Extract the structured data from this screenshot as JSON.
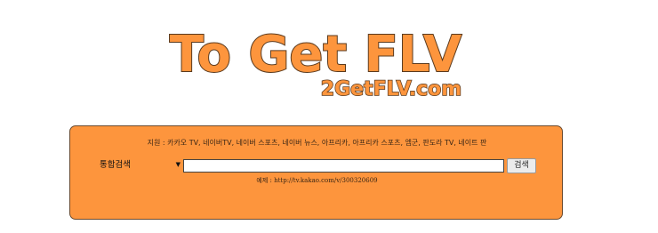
{
  "logo": {
    "title": "To Get FLV",
    "subtitle": "2GetFLV.com",
    "fill_color": "#fd953d",
    "outline_color": "#5a3a1e"
  },
  "panel": {
    "background": "#fd953d",
    "supported_text": "지원 : 카카오 TV, 네이버TV, 네이버 스포츠, 네이버 뉴스, 아프리카, 아프리카 스포츠, 엠군, 판도라 TV, 네이트 판",
    "select": {
      "selected": "통합검색",
      "arrow_icon": "chevron-down-icon"
    },
    "input": {
      "value": "",
      "placeholder": ""
    },
    "search_button_label": "검색",
    "example_text": "예제 : http://tv.kakao.com/v/300320609"
  }
}
